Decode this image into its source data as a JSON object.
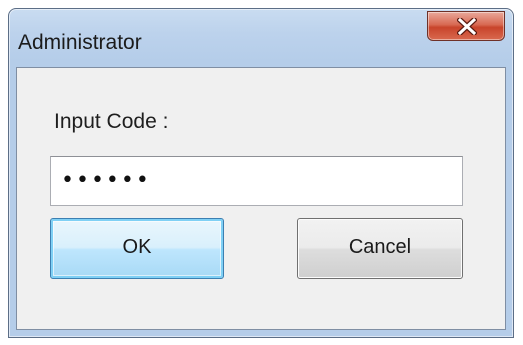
{
  "dialog": {
    "title": "Administrator",
    "close_icon": "close-x-icon",
    "prompt_label": "Input Code :",
    "code_field": {
      "masked_value": "••••••"
    },
    "ok_label": "OK",
    "cancel_label": "Cancel"
  },
  "colors": {
    "frame": "#b5cde9",
    "close_button": "#c8442b",
    "client_background": "#f0f0f0",
    "default_button_border": "#3c7fb1"
  }
}
